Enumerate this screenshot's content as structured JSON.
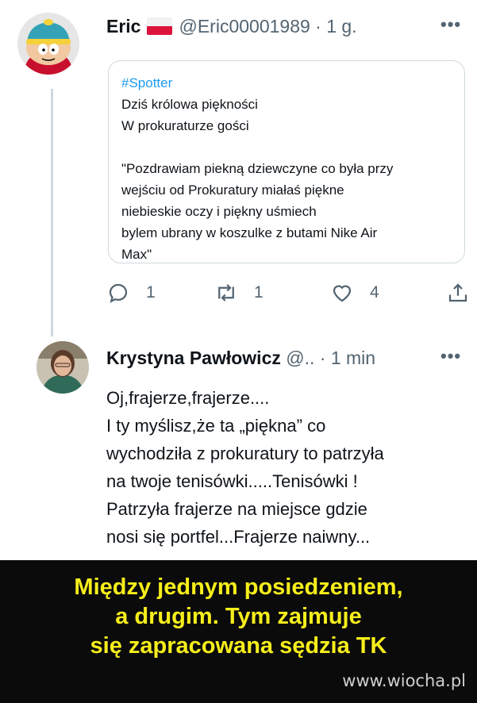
{
  "tweet1": {
    "author_name": "Eric",
    "handle_time": "@Eric00001989 · 1 g.",
    "more": "•••",
    "quote": {
      "hashtag": "#Spotter",
      "lines": [
        "Dziś królowa piękności",
        "W prokuraturze gości",
        "",
        "\"Pozdrawiam piekną dziewczyne co była przy",
        "wejściu od Prokuratury miałaś piękne",
        "niebieskie oczy i piękny uśmiech",
        "bylem ubrany w koszulke z butami Nike Air",
        "Max\""
      ]
    },
    "actions": {
      "reply_count": "1",
      "retweet_count": "1",
      "like_count": "4"
    }
  },
  "tweet2": {
    "author_name": "Krystyna Pawłowicz",
    "handle_time": "@.. · 1 min",
    "more": "•••",
    "lines": [
      "Oj,frajerze,frajerze....",
      "I ty myślisz,że ta „piękna” co",
      "wychodziła z prokuratury to patrzyła",
      "na twoje tenisówki.....Tenisówki !",
      "Patrzyła frajerze na miejsce gdzie",
      "nosi się portfel...Frajerze naiwny..."
    ]
  },
  "caption": {
    "lines": [
      "Między jednym posiedzeniem,",
      "a drugim. Tym zajmuje",
      "się zapracowana sędzia TK"
    ]
  },
  "watermark": "www.wiocha.pl",
  "colors": {
    "link": "#1d9bf0",
    "caption_text": "#f6ee1b",
    "caption_bg": "#0b0b0b",
    "muted": "#536471"
  },
  "icons": [
    "reply-icon",
    "retweet-icon",
    "like-icon",
    "share-icon",
    "poland-flag-icon"
  ]
}
